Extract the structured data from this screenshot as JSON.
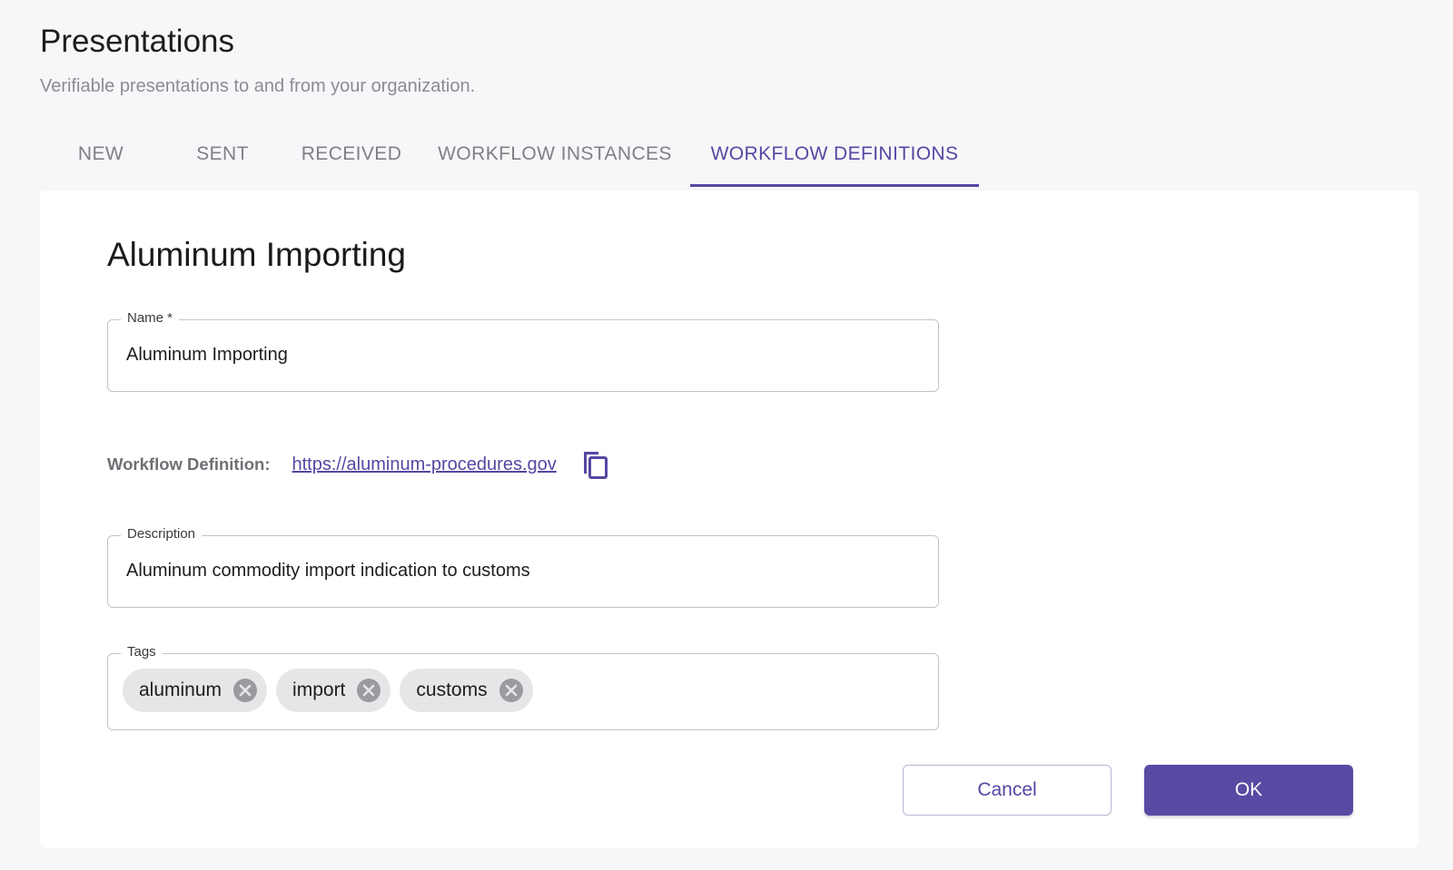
{
  "header": {
    "title": "Presentations",
    "subtitle": "Verifiable presentations to and from your organization."
  },
  "tabs": [
    {
      "label": "NEW",
      "active": false
    },
    {
      "label": "SENT",
      "active": false
    },
    {
      "label": "RECEIVED",
      "active": false
    },
    {
      "label": "WORKFLOW INSTANCES",
      "active": false
    },
    {
      "label": "WORKFLOW DEFINITIONS",
      "active": true
    }
  ],
  "form": {
    "title": "Aluminum Importing",
    "name_label": "Name *",
    "name_value": "Aluminum Importing",
    "workflow_label": "Workflow Definition:",
    "workflow_link": "https://aluminum-procedures.gov",
    "description_label": "Description",
    "description_value": "Aluminum commodity import indication to customs",
    "tags_label": "Tags",
    "tags": [
      "aluminum",
      "import",
      "customs"
    ]
  },
  "actions": {
    "cancel_label": "Cancel",
    "ok_label": "OK"
  },
  "icons": {
    "copy": "copy-icon",
    "chip_remove": "close-circle-icon"
  },
  "colors": {
    "accent": "#5647a2",
    "background": "#f7f7f9",
    "card": "#ffffff",
    "chip": "#e6e6e8"
  }
}
